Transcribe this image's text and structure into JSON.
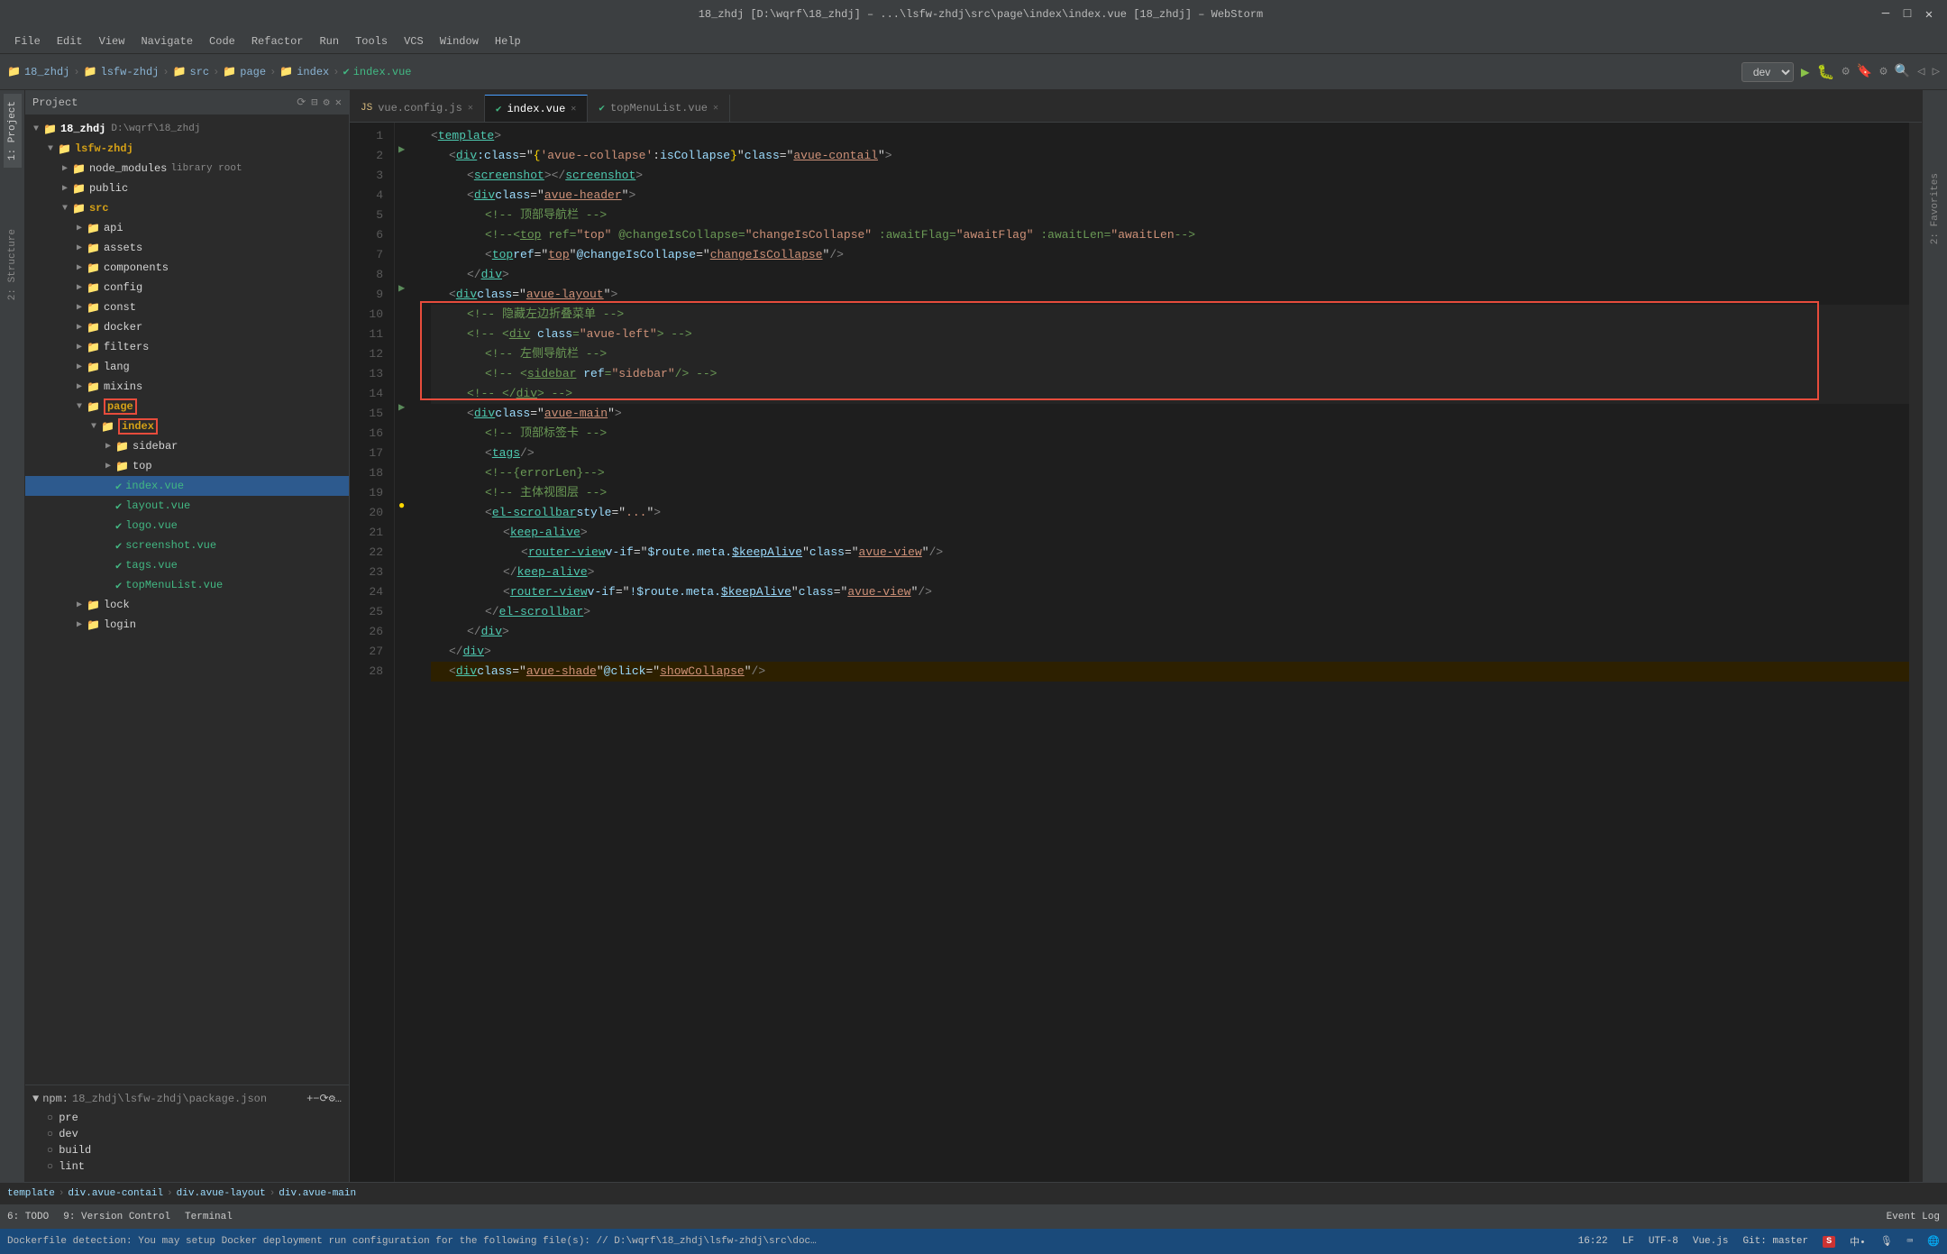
{
  "window": {
    "title": "18_zhdj [D:\\wqrf\\18_zhdj] – ...\\lsfw-zhdj\\src\\page\\index\\index.vue [18_zhdj] – WebStorm"
  },
  "title_bar": {
    "title": "18_zhdj [D:\\wqrf\\18_zhdj] – ...\\lsfw-zhdj\\src\\page\\index\\index.vue [18_zhdj] – WebStorm",
    "minimize": "─",
    "maximize": "□",
    "close": "✕"
  },
  "menu": {
    "items": [
      "File",
      "Edit",
      "View",
      "Navigate",
      "Code",
      "Refactor",
      "Run",
      "Tools",
      "VCS",
      "Window",
      "Help"
    ]
  },
  "toolbar": {
    "breadcrumbs": [
      "18_zhdj",
      "lsfw-zhdj",
      "src",
      "page",
      "index",
      "index.vue"
    ],
    "dev_label": "dev",
    "run_icon": "▶",
    "debug_icon": "🐛"
  },
  "sidebar": {
    "panel_title": "Project",
    "tree": [
      {
        "id": "18_zhdj",
        "label": "18_zhdj",
        "path": "D:\\wqrf\\18_zhdj",
        "indent": 0,
        "type": "root",
        "expanded": true
      },
      {
        "id": "lsfw-zhdj",
        "label": "lsfw-zhdj",
        "indent": 1,
        "type": "folder",
        "expanded": true
      },
      {
        "id": "node_modules",
        "label": "node_modules",
        "indent": 2,
        "type": "folder",
        "extra": "library root"
      },
      {
        "id": "public",
        "label": "public",
        "indent": 2,
        "type": "folder"
      },
      {
        "id": "src",
        "label": "src",
        "indent": 2,
        "type": "folder",
        "expanded": true
      },
      {
        "id": "api",
        "label": "api",
        "indent": 3,
        "type": "folder"
      },
      {
        "id": "assets",
        "label": "assets",
        "indent": 3,
        "type": "folder"
      },
      {
        "id": "components",
        "label": "components",
        "indent": 3,
        "type": "folder"
      },
      {
        "id": "config",
        "label": "config",
        "indent": 3,
        "type": "folder"
      },
      {
        "id": "const",
        "label": "const",
        "indent": 3,
        "type": "folder"
      },
      {
        "id": "docker",
        "label": "docker",
        "indent": 3,
        "type": "folder"
      },
      {
        "id": "filters",
        "label": "filters",
        "indent": 3,
        "type": "folder"
      },
      {
        "id": "lang",
        "label": "lang",
        "indent": 3,
        "type": "folder"
      },
      {
        "id": "mixins",
        "label": "mixins",
        "indent": 3,
        "type": "folder"
      },
      {
        "id": "page",
        "label": "page",
        "indent": 3,
        "type": "folder",
        "expanded": true,
        "red_box": true
      },
      {
        "id": "index_folder",
        "label": "index",
        "indent": 4,
        "type": "folder",
        "expanded": true,
        "red_box": true
      },
      {
        "id": "sidebar_folder",
        "label": "sidebar",
        "indent": 5,
        "type": "folder"
      },
      {
        "id": "top_folder",
        "label": "top",
        "indent": 5,
        "type": "folder"
      },
      {
        "id": "index_vue",
        "label": "index.vue",
        "indent": 5,
        "type": "vue",
        "active": true
      },
      {
        "id": "layout_vue",
        "label": "layout.vue",
        "indent": 5,
        "type": "vue"
      },
      {
        "id": "logo_vue",
        "label": "logo.vue",
        "indent": 5,
        "type": "vue"
      },
      {
        "id": "screenshot_vue",
        "label": "screenshot.vue",
        "indent": 5,
        "type": "vue"
      },
      {
        "id": "tags_vue",
        "label": "tags.vue",
        "indent": 5,
        "type": "vue"
      },
      {
        "id": "topMenuList_vue",
        "label": "topMenuList.vue",
        "indent": 5,
        "type": "vue"
      },
      {
        "id": "lock_folder",
        "label": "lock",
        "indent": 3,
        "type": "folder"
      },
      {
        "id": "login_folder",
        "label": "login",
        "indent": 3,
        "type": "folder"
      }
    ],
    "npm_label": "npm:",
    "npm_scripts": [
      "pre",
      "dev",
      "build",
      "lint"
    ]
  },
  "editor": {
    "tabs": [
      {
        "id": "vue_config",
        "label": "vue.config.js",
        "type": "js",
        "active": false
      },
      {
        "id": "index_vue",
        "label": "index.vue",
        "type": "vue",
        "active": true
      },
      {
        "id": "topMenuList_vue",
        "label": "topMenuList.vue",
        "type": "vue",
        "active": false
      }
    ],
    "lines": [
      {
        "num": 1,
        "content": "<template>",
        "type": "template"
      },
      {
        "num": 2,
        "content": "  <div :class=\"{'avue--collapse':isCollapse}\" class=\"avue-contail\">",
        "type": "code"
      },
      {
        "num": 3,
        "content": "    <screenshot></screenshot>",
        "type": "code"
      },
      {
        "num": 4,
        "content": "    <div class=\"avue-header\">",
        "type": "code"
      },
      {
        "num": 5,
        "content": "      <!-- 顶部导航栏 -->",
        "type": "comment"
      },
      {
        "num": 6,
        "content": "      <!--<top ref=\"top\" @changeIsCollapse=\"changeIsCollapse\" :awaitFlag=\"awaitFlag\" :awaitLen=\"awaitLen-->",
        "type": "comment"
      },
      {
        "num": 7,
        "content": "      <top ref=\"top\" @changeIsCollapse=\"changeIsCollapse\"/>",
        "type": "code"
      },
      {
        "num": 8,
        "content": "    </div>",
        "type": "code"
      },
      {
        "num": 9,
        "content": "  <div class=\"avue-layout\">",
        "type": "code"
      },
      {
        "num": 10,
        "content": "    <!-- 隐藏左边折叠菜单 -->",
        "type": "comment",
        "box": true
      },
      {
        "num": 11,
        "content": "    <!-- <div class=\"avue-left\"> -->",
        "type": "comment",
        "box": true
      },
      {
        "num": 12,
        "content": "      <!-- 左侧导航栏 -->",
        "type": "comment",
        "box": true
      },
      {
        "num": 13,
        "content": "      <!-- <sidebar ref=\"sidebar\"/> -->",
        "type": "comment",
        "box": true
      },
      {
        "num": 14,
        "content": "    <!-- </div> -->",
        "type": "comment",
        "box": true
      },
      {
        "num": 15,
        "content": "    <div class=\"avue-main\">",
        "type": "code"
      },
      {
        "num": 16,
        "content": "      <!-- 顶部标签卡 -->",
        "type": "comment"
      },
      {
        "num": 17,
        "content": "      <tags/>",
        "type": "code"
      },
      {
        "num": 18,
        "content": "      <!--{errorLen}-->",
        "type": "comment"
      },
      {
        "num": 19,
        "content": "      <!-- 主体视图层 -->",
        "type": "comment"
      },
      {
        "num": 20,
        "content": "      <el-scrollbar style=\"...\">",
        "type": "code"
      },
      {
        "num": 21,
        "content": "        <keep-alive>",
        "type": "code"
      },
      {
        "num": 22,
        "content": "          <router-view v-if=\"$route.meta.$keepAlive\" class=\"avue-view\"/>",
        "type": "code"
      },
      {
        "num": 23,
        "content": "        </keep-alive>",
        "type": "code"
      },
      {
        "num": 24,
        "content": "        <router-view v-if=\"!$route.meta.$keepAlive\" class=\"avue-view\"/>",
        "type": "code"
      },
      {
        "num": 25,
        "content": "      </el-scrollbar>",
        "type": "code"
      },
      {
        "num": 26,
        "content": "    </div>",
        "type": "code"
      },
      {
        "num": 27,
        "content": "  </div>",
        "type": "code"
      },
      {
        "num": 28,
        "content": "  <div class=\"avue-shade\" @click=\"showCollapse\"/>",
        "type": "code"
      }
    ]
  },
  "breadcrumb_bottom": {
    "items": [
      "template",
      "div.avue-contail",
      "div.avue-layout",
      "div.avue-main"
    ]
  },
  "status_bar": {
    "git_branch": "Git: master",
    "position": "16:22",
    "encoding": "UTF-8",
    "line_sep": "LF",
    "file_type": "Vue.js",
    "event_log": "Event Log",
    "notification": "Dockerfile detection: You may setup Docker deployment run configuration for the following file(s): // D:\\wqrf\\18_zhdj\\lsfw-zhdj\\src\\docker\\Dockerfile // // Disable this notification (moments ago)"
  },
  "bottom_tabs": {
    "todo": "6: TODO",
    "version_control": "9: Version Control",
    "terminal": "Terminal"
  },
  "side_tabs": {
    "project": "1: Project",
    "structure": "2: Structure",
    "favorites": "2: Favorites",
    "npm": "npm"
  }
}
